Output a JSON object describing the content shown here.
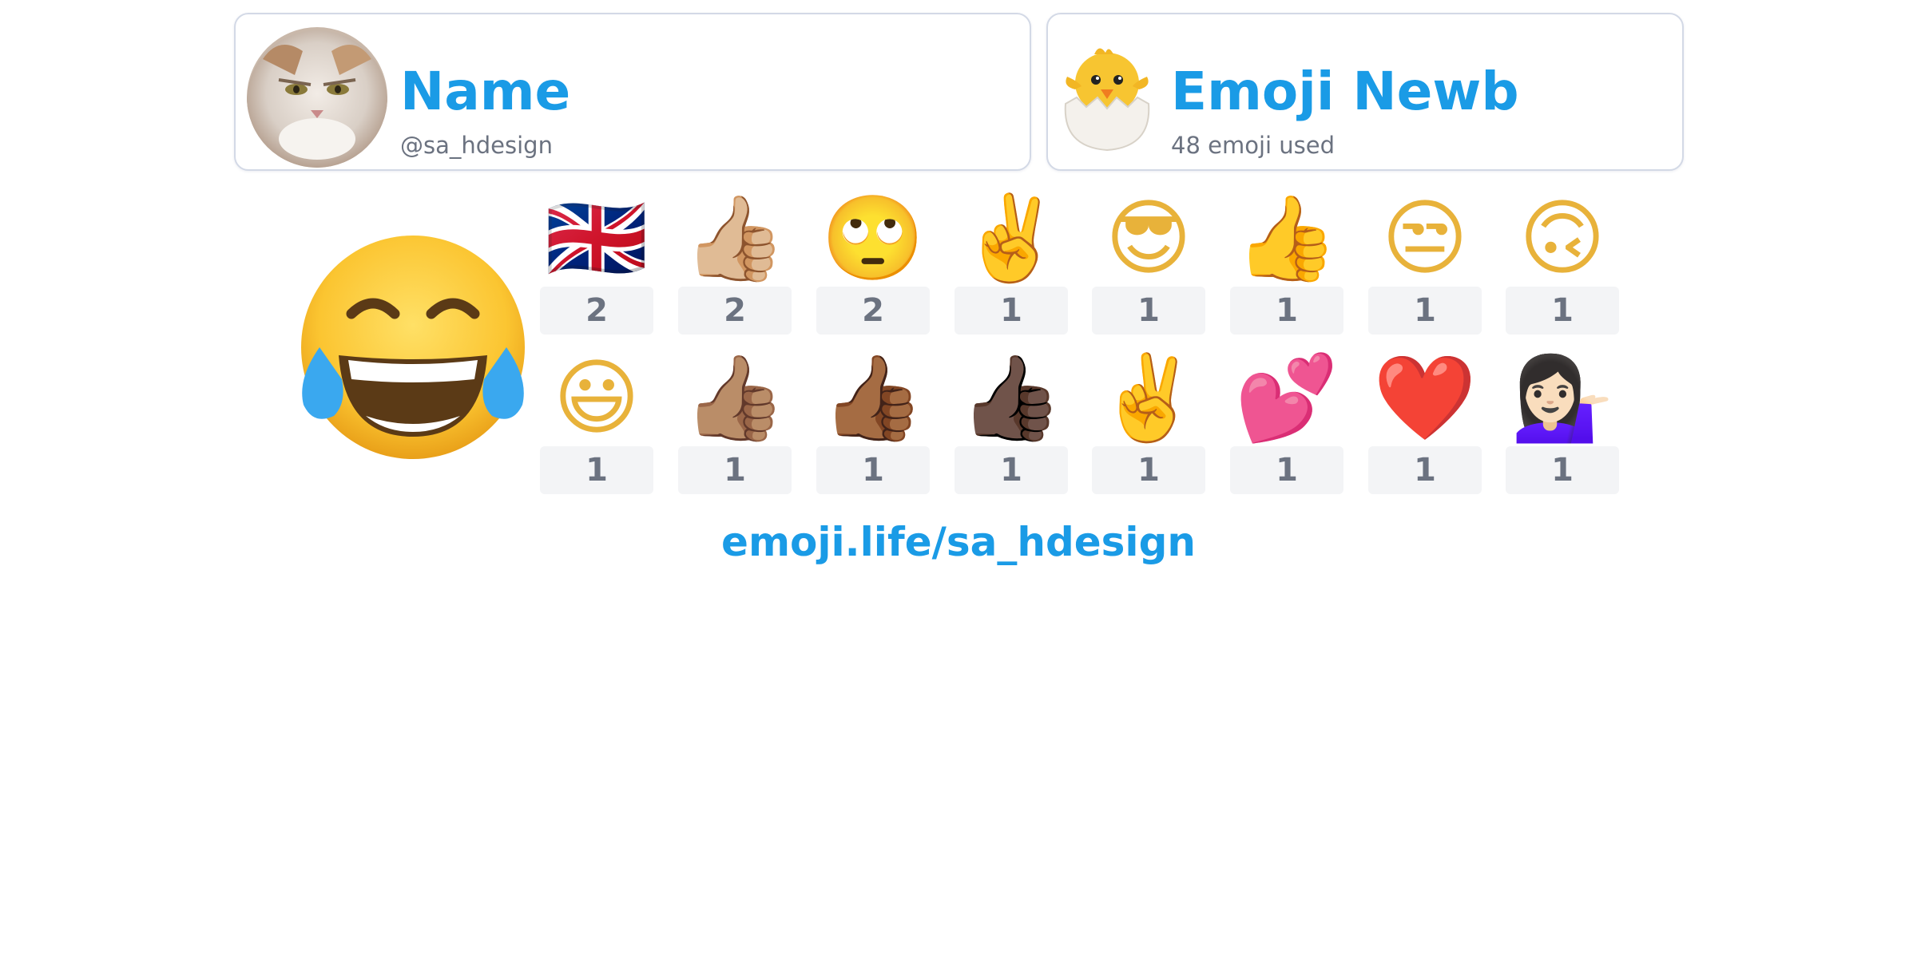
{
  "profile": {
    "name": "Name",
    "handle": "@sa_hdesign",
    "avatar_icon": "cat-avatar-photo"
  },
  "rank": {
    "title": "Emoji Newb",
    "subtitle": "48 emoji used",
    "icon": "hatching-chick-icon"
  },
  "top_emoji": {
    "icon": "face-with-tears-of-joy",
    "glyph": "😂"
  },
  "emoji_grid": [
    {
      "icon": "flag-united-kingdom",
      "glyph": "🇬🇧",
      "count": "2"
    },
    {
      "icon": "thumbs-up-light-skin",
      "glyph": "👍🏼",
      "count": "2"
    },
    {
      "icon": "face-with-rolling-eyes",
      "glyph": "🙄",
      "count": "2"
    },
    {
      "icon": "victory-hand",
      "glyph": "✌️",
      "count": "1"
    },
    {
      "icon": "smiling-face-with-sunglasses",
      "glyph": "😎",
      "count": "1"
    },
    {
      "icon": "thumbs-up",
      "glyph": "👍",
      "count": "1"
    },
    {
      "icon": "unamused-face",
      "glyph": "😒",
      "count": "1"
    },
    {
      "icon": "upside-down-face",
      "glyph": "🙃",
      "count": "1"
    },
    {
      "icon": "grinning-face-with-big-eyes",
      "glyph": "😃",
      "count": "1"
    },
    {
      "icon": "thumbs-up-medium-light-skin",
      "glyph": "👍🏽",
      "count": "1"
    },
    {
      "icon": "thumbs-up-medium-dark-skin",
      "glyph": "👍🏾",
      "count": "1"
    },
    {
      "icon": "thumbs-up-dark-skin",
      "glyph": "👍🏿",
      "count": "1"
    },
    {
      "icon": "victory-hand",
      "glyph": "✌️",
      "count": "1"
    },
    {
      "icon": "two-hearts",
      "glyph": "💕",
      "count": "1"
    },
    {
      "icon": "red-heart",
      "glyph": "❤️",
      "count": "1"
    },
    {
      "icon": "person-tipping-hand",
      "glyph": "💁🏻‍♀️",
      "count": "1"
    }
  ],
  "footer": {
    "link_text": "emoji.life/sa_hdesign"
  },
  "colors": {
    "accent": "#1a9be6",
    "muted_text": "#6b7280",
    "count_bg": "#f3f4f6",
    "card_border": "#d3d9e6"
  }
}
